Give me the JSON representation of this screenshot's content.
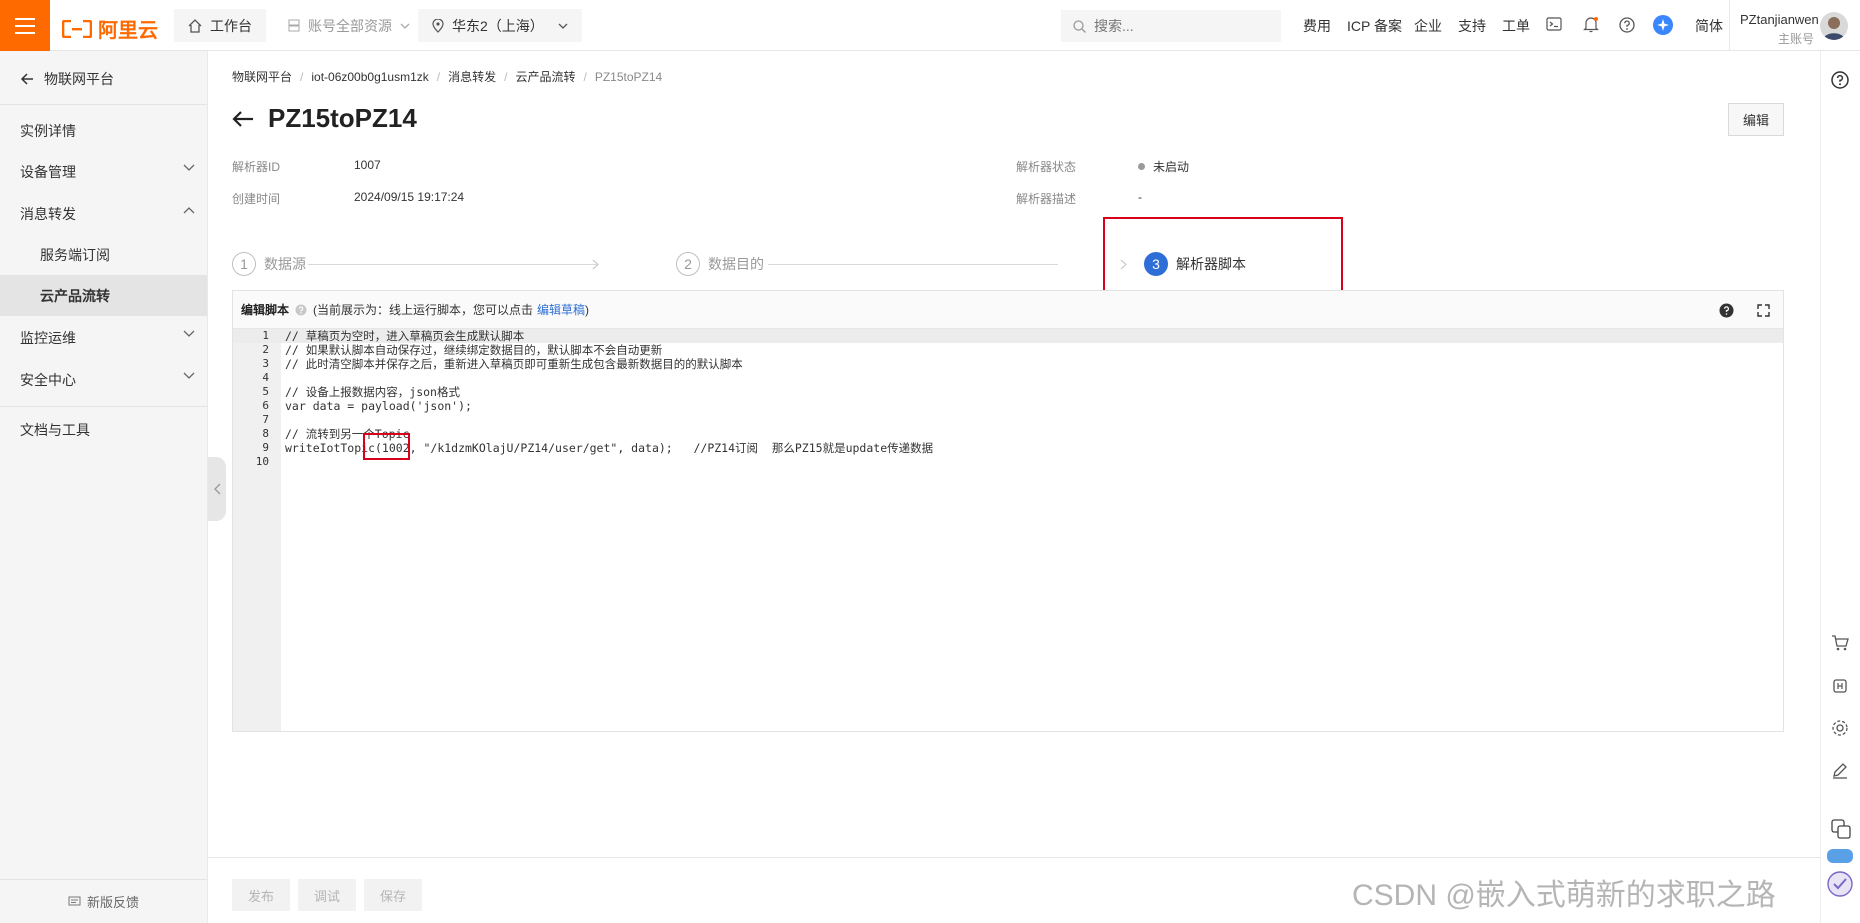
{
  "topbar": {
    "logo_text": "阿里云",
    "workbench": "工作台",
    "account_resources": "账号全部资源",
    "region": "华东2（上海）",
    "search_placeholder": "搜索...",
    "nav": [
      "费用",
      "ICP 备案",
      "企业",
      "支持",
      "工单"
    ],
    "lang": "简体",
    "user_name": "PZtanjianwen",
    "user_role": "主账号",
    "accent_color": "#ff6a00"
  },
  "sidebar": {
    "back_label": "物联网平台",
    "items": [
      {
        "label": "实例详情"
      },
      {
        "label": "设备管理"
      },
      {
        "label": "消息转发"
      },
      {
        "label": "服务端订阅"
      },
      {
        "label": "云产品流转"
      },
      {
        "label": "监控运维"
      },
      {
        "label": "安全中心"
      },
      {
        "label": "文档与工具"
      }
    ],
    "feedback": "新版反馈"
  },
  "breadcrumb": [
    "物联网平台",
    "iot-06z00b0g1usm1zk",
    "消息转发",
    "云产品流转",
    "PZ15toPZ14"
  ],
  "page": {
    "title": "PZ15toPZ14",
    "edit_button": "编辑"
  },
  "info": {
    "parser_id_label": "解析器ID",
    "parser_id_value": "1007",
    "created_label": "创建时间",
    "created_value": "2024/09/15 19:17:24",
    "status_label": "解析器状态",
    "status_value": "未启动",
    "desc_label": "解析器描述",
    "desc_value": "-"
  },
  "steps": [
    {
      "num": "1",
      "label": "数据源"
    },
    {
      "num": "2",
      "label": "数据目的"
    },
    {
      "num": "3",
      "label": "解析器脚本"
    }
  ],
  "editor": {
    "title": "编辑脚本",
    "hint_prefix": "(当前展示为：线上运行脚本，您可以点击",
    "hint_link": "编辑草稿",
    "hint_suffix": ")",
    "lines": [
      "// 草稿页为空时，进入草稿页会生成默认脚本",
      "// 如果默认脚本自动保存过，继续绑定数据目的，默认脚本不会自动更新",
      "// 此时清空脚本并保存之后，重新进入草稿页即可重新生成包含最新数据目的的默认脚本",
      "",
      "// 设备上报数据内容，json格式",
      "var data = payload('json');",
      "",
      "// 流转到另一个Topic",
      "writeIotTopic(1002, \"/k1dzmKOlajU/PZ14/user/get\", data);   //PZ14订阅  那么PZ15就是update传递数据",
      ""
    ],
    "line_numbers": [
      "1",
      "2",
      "3",
      "4",
      "5",
      "6",
      "7",
      "8",
      "9",
      "10"
    ]
  },
  "footer": {
    "publish": "发布",
    "debug": "调试",
    "save": "保存"
  },
  "watermark": "CSDN @嵌入式萌新的求职之路"
}
